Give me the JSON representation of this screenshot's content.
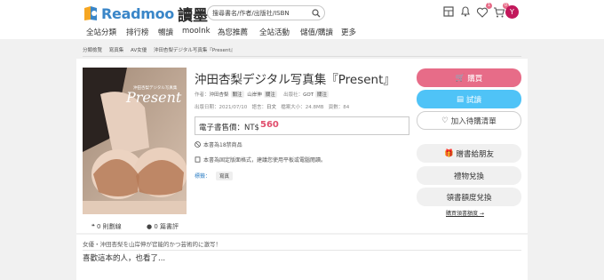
{
  "header": {
    "logo_text": "Readmoo",
    "logo_cn": "讀墨",
    "search_placeholder": "搜尋書名/作者/出版社/ISBN",
    "cart_badge": "0",
    "heart_badge": "1",
    "avatar_letter": "Y",
    "accent": "#e76c88"
  },
  "nav": {
    "items": [
      "全站分類",
      "排行榜",
      "暢讀",
      "mooInk",
      "為您推薦",
      "全站活動",
      "儲值/購讀",
      "更多"
    ]
  },
  "breadcrumb": [
    "分類檢覽",
    "寫真集",
    "AV女優",
    "沖田杏梨デジタル写真集『Present』"
  ],
  "book": {
    "title": "沖田杏梨デジタル写真集『Present』",
    "author_label": "作者：",
    "author": "沖田杏梨",
    "follow": "關注",
    "photographer": "山岸伸",
    "publisher_label": "出版社：",
    "publisher": "GOT",
    "date_label": "出版日期：",
    "date": "2021/07/10",
    "lang_label": "語言：",
    "lang": "日文",
    "size_label": "檔案大小：",
    "size": "24.8MB",
    "pages_label": "頁數：",
    "pages": "84",
    "price_label": "電子書售價：NT$",
    "price": "560",
    "note_age": "本書為18禁商品",
    "note_layout": "本書為固定版面格式，建議您使用平板或電腦閱讀。",
    "genre_label": "標籤：",
    "genre": "寫真",
    "cover_caption": "Present",
    "cover_subtitle": "沖田杏梨デジタル写真集"
  },
  "stats": {
    "comments": "0 則劃線",
    "reviews": "0 篇書評"
  },
  "actions": {
    "buy": "購買",
    "try": "試讀",
    "wish": "加入待購清單",
    "gift": "贈書給朋友",
    "redeem": "禮物兌換",
    "quota": "領書額度兌換",
    "quota_link": "購買領書額度 →"
  },
  "description": {
    "text": "女優・沖田杏梨を山岸伸が官能的かつ芸術的に激写！",
    "related": "喜歡這本的人，也看了..."
  }
}
